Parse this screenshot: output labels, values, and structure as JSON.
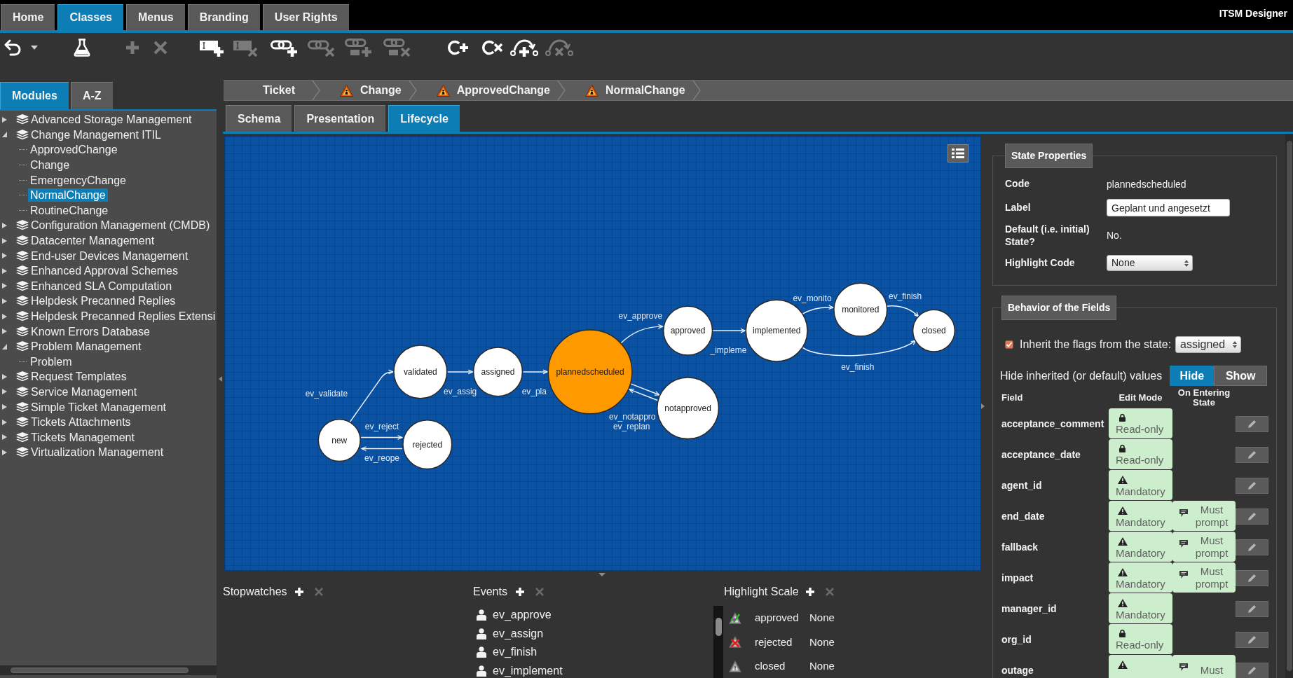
{
  "top_nav": {
    "tabs": [
      {
        "label": "Home",
        "selected": false
      },
      {
        "label": "Classes",
        "selected": true
      },
      {
        "label": "Menus",
        "selected": false
      },
      {
        "label": "Branding",
        "selected": false
      },
      {
        "label": "User Rights",
        "selected": false
      }
    ],
    "app_title": "ITSM Designer"
  },
  "toolbar": {
    "buttons": [
      {
        "disabled": false
      },
      {
        "disabled": false
      },
      {
        "disabled": true
      },
      {
        "disabled": true
      },
      {
        "disabled": false
      },
      {
        "disabled": true
      },
      {
        "disabled": false
      },
      {
        "disabled": true
      },
      {
        "disabled": true
      },
      {
        "disabled": true
      },
      {
        "disabled": false
      },
      {
        "disabled": false
      },
      {
        "disabled": false
      },
      {
        "disabled": true
      }
    ]
  },
  "left_panel": {
    "tabs": [
      {
        "label": "Modules",
        "selected": true
      },
      {
        "label": "A-Z",
        "selected": false
      }
    ],
    "tree": [
      {
        "label": "Advanced Storage Management",
        "expanded": false,
        "selected": false
      },
      {
        "label": "Change Management ITIL",
        "expanded": true,
        "selected": false,
        "children": [
          {
            "label": "ApprovedChange",
            "selected": false
          },
          {
            "label": "Change",
            "selected": false
          },
          {
            "label": "EmergencyChange",
            "selected": false
          },
          {
            "label": "NormalChange",
            "selected": true
          },
          {
            "label": "RoutineChange",
            "selected": false
          }
        ]
      },
      {
        "label": "Configuration Management (CMDB)",
        "expanded": false,
        "selected": false
      },
      {
        "label": "Datacenter Management",
        "expanded": false,
        "selected": false
      },
      {
        "label": "End-user Devices Management",
        "expanded": false,
        "selected": false
      },
      {
        "label": "Enhanced Approval Schemes",
        "expanded": false,
        "selected": false
      },
      {
        "label": "Enhanced SLA Computation",
        "expanded": false,
        "selected": false
      },
      {
        "label": "Helpdesk Precanned Replies",
        "expanded": false,
        "selected": false
      },
      {
        "label": "Helpdesk Precanned Replies Extensi",
        "expanded": false,
        "selected": false
      },
      {
        "label": "Known Errors Database",
        "expanded": false,
        "selected": false
      },
      {
        "label": "Problem Management",
        "expanded": true,
        "selected": false,
        "children": [
          {
            "label": "Problem",
            "selected": false
          }
        ]
      },
      {
        "label": "Request Templates",
        "expanded": false,
        "selected": false
      },
      {
        "label": "Service Management",
        "expanded": false,
        "selected": false
      },
      {
        "label": "Simple Ticket Management",
        "expanded": false,
        "selected": false
      },
      {
        "label": "Tickets Attachments",
        "expanded": false,
        "selected": false
      },
      {
        "label": "Tickets Management",
        "expanded": false,
        "selected": false
      },
      {
        "label": "Virtualization Management",
        "expanded": false,
        "selected": false
      }
    ]
  },
  "breadcrumb": [
    {
      "label": "Ticket",
      "warning": false
    },
    {
      "label": "Change",
      "warning": true
    },
    {
      "label": "ApprovedChange",
      "warning": true
    },
    {
      "label": "NormalChange",
      "warning": true
    }
  ],
  "sub_tabs": [
    {
      "label": "Schema",
      "selected": false
    },
    {
      "label": "Presentation",
      "selected": false
    },
    {
      "label": "Lifecycle",
      "selected": true
    }
  ],
  "lifecycle": {
    "states": [
      {
        "label": "new",
        "selected": false
      },
      {
        "label": "rejected",
        "selected": false
      },
      {
        "label": "validated",
        "selected": false
      },
      {
        "label": "assigned",
        "selected": false
      },
      {
        "label": "plannedscheduled",
        "selected": true
      },
      {
        "label": "approved",
        "selected": false
      },
      {
        "label": "notapproved",
        "selected": false
      },
      {
        "label": "implemented",
        "selected": false
      },
      {
        "label": "monitored",
        "selected": false
      },
      {
        "label": "closed",
        "selected": false
      }
    ],
    "transitions": [
      "ev_validate",
      "ev_assig",
      "ev_pla",
      "ev_approve",
      "_impleme",
      "ev_monito",
      "ev_finish",
      "ev_finish",
      "ev_notappro",
      "ev_replan",
      "ev_reject",
      "ev_reope"
    ]
  },
  "state_properties": {
    "title": "State Properties",
    "rows": [
      {
        "kind": "text",
        "label": "Code",
        "value": "plannedscheduled"
      },
      {
        "kind": "input",
        "label": "Label",
        "value": "Geplant und angesetzt"
      },
      {
        "kind": "text",
        "label": "Default (i.e. initial) State?",
        "value": "No."
      },
      {
        "kind": "select",
        "label": "Highlight Code",
        "value": "None"
      }
    ]
  },
  "fields_behavior": {
    "title": "Behavior of the Fields",
    "inherit": {
      "checked": true,
      "label": "Inherit the flags from the state:",
      "value": "assigned"
    },
    "hide_inherited": {
      "label": "Hide inherited (or default) values",
      "options": [
        {
          "label": "Hide",
          "selected": true
        },
        {
          "label": "Show",
          "selected": false
        }
      ]
    },
    "columns": [
      "Field",
      "Edit Mode",
      "On Entering State"
    ],
    "rows": [
      {
        "field": "acceptance_comment",
        "edit_mode": {
          "kind": "readonly",
          "label": "Read-only"
        }
      },
      {
        "field": "acceptance_date",
        "edit_mode": {
          "kind": "readonly",
          "label": "Read-only"
        }
      },
      {
        "field": "agent_id",
        "edit_mode": {
          "kind": "mandatory",
          "label": "Mandatory"
        }
      },
      {
        "field": "end_date",
        "edit_mode": {
          "kind": "mandatory",
          "label": "Mandatory"
        },
        "on_entering": "Must prompt"
      },
      {
        "field": "fallback",
        "edit_mode": {
          "kind": "mandatory",
          "label": "Mandatory"
        },
        "on_entering": "Must prompt"
      },
      {
        "field": "impact",
        "edit_mode": {
          "kind": "mandatory",
          "label": "Mandatory"
        },
        "on_entering": "Must prompt"
      },
      {
        "field": "manager_id",
        "edit_mode": {
          "kind": "mandatory",
          "label": "Mandatory"
        }
      },
      {
        "field": "org_id",
        "edit_mode": {
          "kind": "readonly",
          "label": "Read-only"
        }
      },
      {
        "field": "outage",
        "edit_mode": {
          "kind": "mandatory"
        },
        "on_entering": "Must"
      }
    ]
  },
  "stopwatches": {
    "title": "Stopwatches",
    "actions": [
      {
        "disabled": false
      },
      {
        "disabled": true
      }
    ]
  },
  "events": {
    "title": "Events",
    "actions": [
      {
        "disabled": false
      },
      {
        "disabled": true
      }
    ],
    "items": [
      "ev_approve",
      "ev_assign",
      "ev_finish",
      "ev_implement"
    ]
  },
  "highlight_scale": {
    "title": "Highlight Scale",
    "actions": [
      {
        "disabled": false
      },
      {
        "disabled": true
      }
    ],
    "items": [
      {
        "kind": "check",
        "label": "approved",
        "value": "None"
      },
      {
        "kind": "cross",
        "label": "rejected",
        "value": "None"
      },
      {
        "kind": "plain",
        "label": "closed",
        "value": "None"
      }
    ]
  }
}
